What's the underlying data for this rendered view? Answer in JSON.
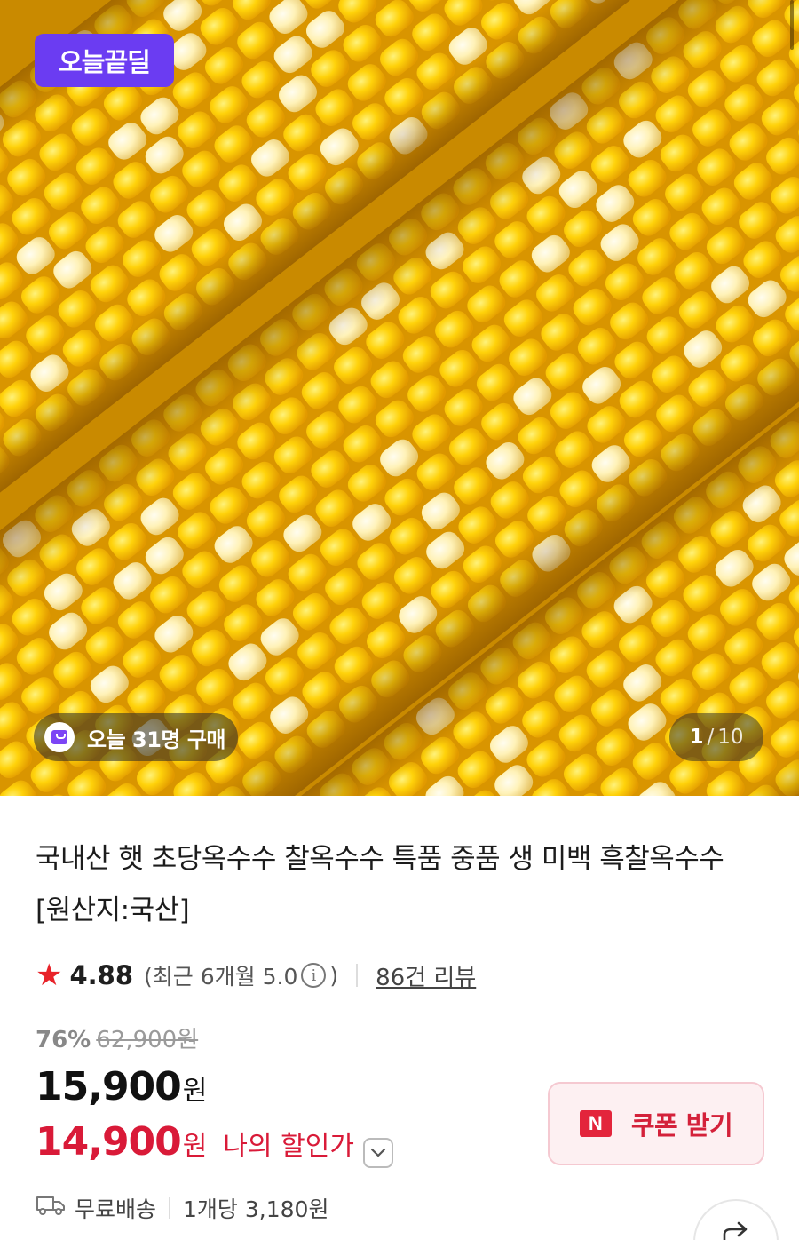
{
  "hero": {
    "badge_label": "오늘끝딜",
    "purchase_text": "오늘 31명 구매",
    "page_current": "1",
    "page_sep": "/",
    "page_total": "10"
  },
  "product": {
    "title": "국내산 햇 초당옥수수 찰옥수수 특품 중품 생 미백 흑찰옥수수 [원산지:국산]",
    "rating": "4.88",
    "recent_rating_prefix": "(최근 6개월 5.0",
    "recent_rating_suffix": ")",
    "review_count": "86건 리뷰",
    "discount_percent": "76%",
    "original_price": "62,900원",
    "price": "15,900",
    "price_unit": "원",
    "my_price": "14,900",
    "my_price_unit": "원",
    "my_price_label": "나의 할인가",
    "coupon_label": "쿠폰 받기",
    "coupon_logo": "N",
    "shipping": "무료배송",
    "unit_price": "1개당 3,180원"
  },
  "colors": {
    "brand_purple": "#6b3cf2",
    "discount_red": "#d91a38",
    "star_red": "#e8232a"
  },
  "icons": {
    "star": "star-icon",
    "info": "info-icon",
    "chevron": "chevron-down-icon",
    "truck": "truck-icon",
    "share": "share-icon",
    "bag": "shopping-bag-icon"
  }
}
